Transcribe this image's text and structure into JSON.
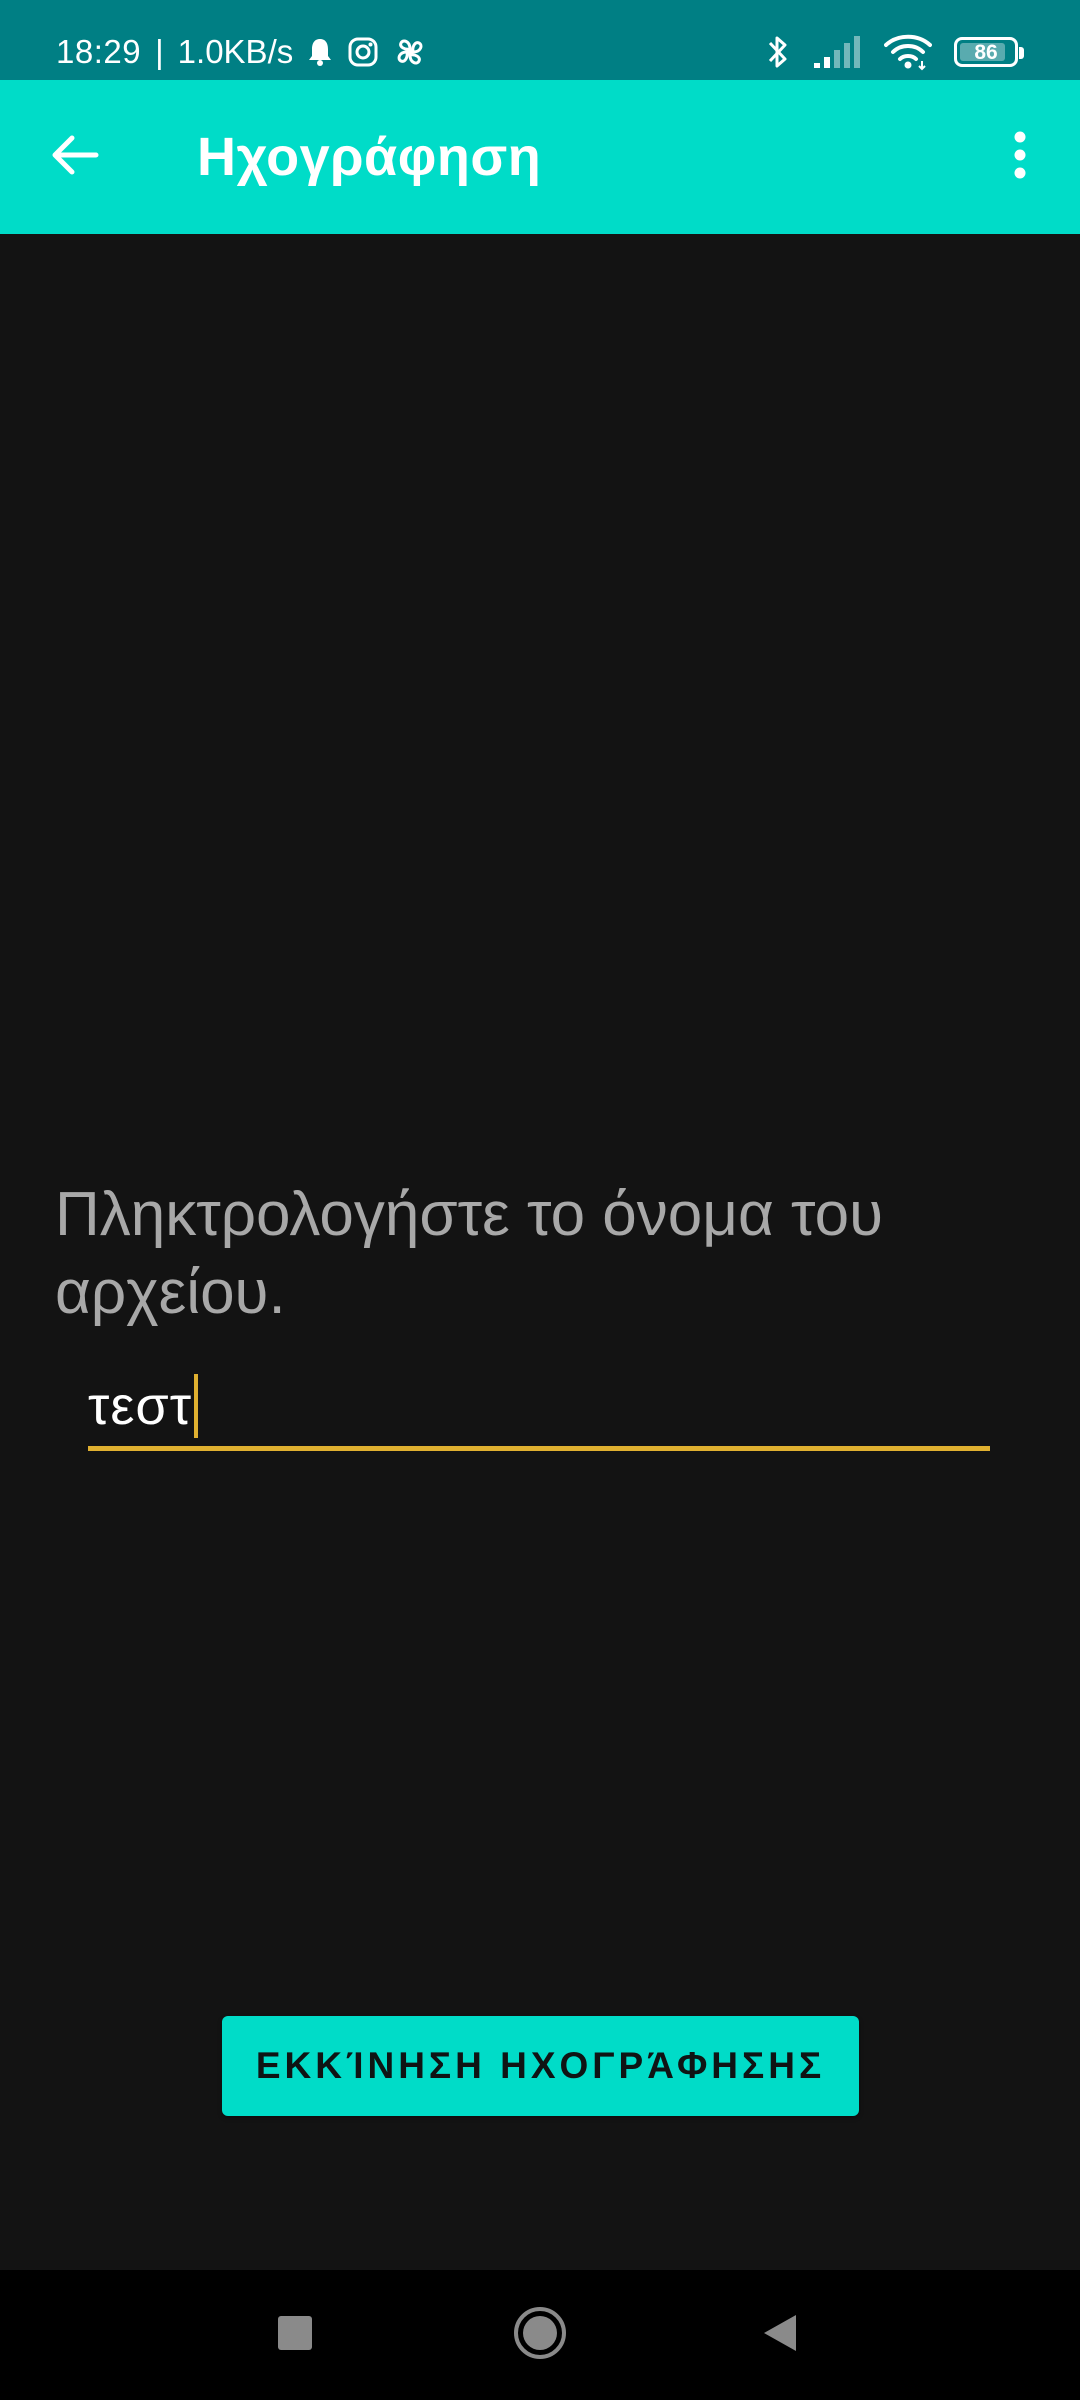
{
  "status_bar": {
    "time": "18:29",
    "separator": "|",
    "network_speed": "1.0KB/s",
    "left_icons": [
      "bell-icon",
      "instagram-icon",
      "pinwheel-icon"
    ],
    "right_icons": [
      "bluetooth-icon",
      "signal-icon",
      "wifi-icon",
      "battery-icon"
    ],
    "battery_level": "86",
    "battery_fraction": 0.86
  },
  "app_bar": {
    "title": "Ηχογράφηση",
    "back_icon": "arrow-back-icon",
    "menu_icon": "more-vert-icon"
  },
  "main": {
    "prompt": "Πληκτρολογήστε το όνομα του αρχείου.",
    "filename_value": "τεστ",
    "start_button_label": "ΕΚΚΊΝΗΣΗ ΗΧΟΓΡΆΦΗΣΗΣ"
  },
  "nav_bar": {
    "buttons": [
      "recents-icon",
      "home-icon",
      "back-icon"
    ]
  },
  "colors": {
    "status_bar": "#007f84",
    "accent": "#00dcc8",
    "background": "#131313",
    "underline": "#e0b030",
    "prompt_text": "#a8a8a8"
  }
}
